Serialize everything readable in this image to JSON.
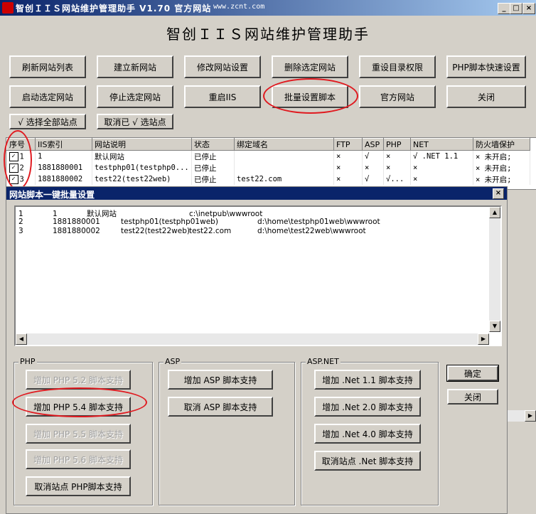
{
  "window": {
    "title": "智创ＩＩＳ网站维护管理助手 V1.70 官方网站",
    "url": "www.zcnt.com",
    "minimize": "_",
    "maximize": "□",
    "close": "×"
  },
  "app_title": "智创ＩＩＳ网站维护管理助手",
  "toolbar": {
    "refresh": "刷新网站列表",
    "create": "建立新网站",
    "modify": "修改网站设置",
    "delete": "删除选定网站",
    "reset_perm": "重设目录权限",
    "php_quick": "PHP脚本快速设置",
    "start": "启动选定网站",
    "stop": "停止选定网站",
    "restart": "重启IIS",
    "batch": "批量设置脚本",
    "official": "官方网站",
    "close": "关闭",
    "select_all": "√ 选择全部站点",
    "deselect": "取消已 √ 选站点"
  },
  "grid": {
    "headers": [
      "序号",
      "IIS索引",
      "网站说明",
      "状态",
      "绑定域名",
      "FTP",
      "ASP",
      "PHP",
      "NET",
      "防火墙保护"
    ],
    "rows": [
      {
        "no": "1",
        "index": "1",
        "desc": "默认网站",
        "state": "已停止",
        "domain": "",
        "ftp": "×",
        "asp": "√",
        "php": "×",
        "net": "√ .NET 1.1",
        "fw": "× 未开启;"
      },
      {
        "no": "2",
        "index": "1881880001",
        "desc": "testphp01(testphp0...",
        "state": "已停止",
        "domain": "",
        "ftp": "×",
        "asp": "×",
        "php": "×",
        "net": "×",
        "fw": "× 未开启;"
      },
      {
        "no": "3",
        "index": "1881880002",
        "desc": "test22(test22web)",
        "state": "已停止",
        "domain": "test22.com",
        "ftp": "×",
        "asp": "√",
        "php": "√...",
        "net": "×",
        "fw": "× 未开启;"
      }
    ]
  },
  "dialog": {
    "title": "网站脚本一键批量设置",
    "close": "×",
    "list": [
      {
        "no": "1",
        "index": "1",
        "desc": "默认网站",
        "domain": "",
        "path": "c:\\inetpub\\wwwroot"
      },
      {
        "no": "2",
        "index": "1881880001",
        "desc": "testphp01(testphp01web)",
        "domain": "",
        "path": "d:\\home\\testphp01web\\wwwroot"
      },
      {
        "no": "3",
        "index": "1881880002",
        "desc": "test22(test22web)",
        "domain": "test22.com",
        "path": "d:\\home\\test22web\\wwwroot"
      }
    ],
    "php": {
      "legend": "PHP",
      "add52": "增加 PHP 5.2 脚本支持",
      "add54": "增加 PHP 5.4 脚本支持",
      "add55": "增加 PHP 5.5 脚本支持",
      "add56": "增加 PHP 5.6 脚本支持",
      "remove": "取消站点 PHP脚本支持"
    },
    "asp": {
      "legend": "ASP",
      "add": "增加 ASP 脚本支持",
      "remove": "取消 ASP 脚本支持"
    },
    "net": {
      "legend": "ASP.NET",
      "add11": "增加 .Net 1.1 脚本支持",
      "add20": "增加 .Net 2.0 脚本支持",
      "add40": "增加 .Net 4.0 脚本支持",
      "remove": "取消站点 .Net 脚本支持"
    },
    "ok": "确定",
    "close_btn": "关闭"
  },
  "highlight_color": "#e0191f"
}
